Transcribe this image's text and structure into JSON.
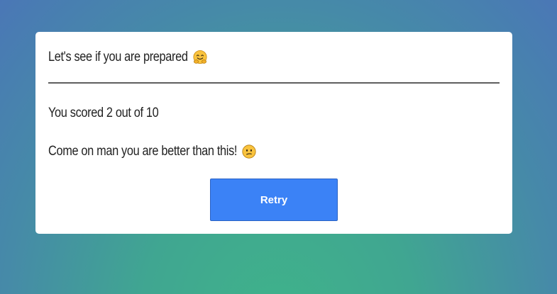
{
  "quiz": {
    "heading": "Let's see if you are prepared",
    "heading_icon": "hugging-face-emoji",
    "score_text": "You scored 2 out of 10",
    "score": 2,
    "total": 10,
    "feedback": "Come on man you are better than this!",
    "feedback_icon": "confused-face-emoji",
    "retry_label": "Retry"
  },
  "colors": {
    "background_top": "#4a77b6",
    "background_bottom": "#3fb38a",
    "card": "#ffffff",
    "button": "#3b82f6",
    "divider": "#5f5f5f"
  }
}
